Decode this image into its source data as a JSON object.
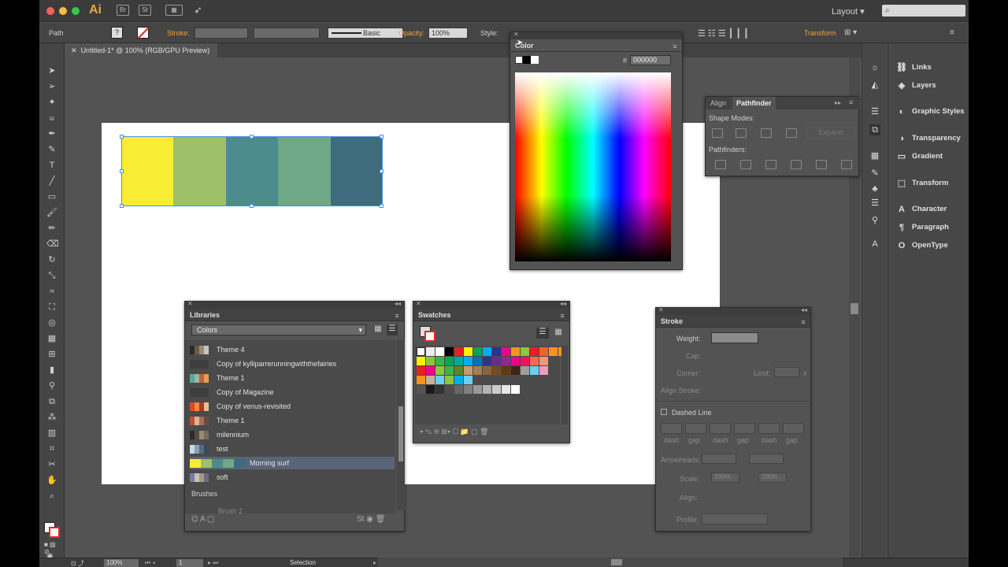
{
  "app": {
    "logo": "Ai",
    "workspace": "Layout",
    "search_placeholder": ""
  },
  "control_bar": {
    "path_label": "Path",
    "stroke_label": "Stroke:",
    "brush_label": "Basic",
    "opacity_label": "Opacity:",
    "opacity_value": "100%",
    "style_label": "Style:",
    "transform_label": "Transform"
  },
  "document": {
    "tab_title": "Untitled-1* @ 100% (RGB/GPU Preview)"
  },
  "artboard": {
    "rects": [
      {
        "color": "#f8ed33"
      },
      {
        "color": "#9dc068"
      },
      {
        "color": "#4c8c8c"
      },
      {
        "color": "#6fa887"
      },
      {
        "color": "#3e6b7d"
      }
    ]
  },
  "color_panel": {
    "title": "Color",
    "hex_label": "#",
    "hex_value": "000000"
  },
  "pathfinder_panel": {
    "tabs": [
      "Align",
      "Pathfinder"
    ],
    "shape_modes_label": "Shape Modes:",
    "expand_label": "Expand",
    "pathfinders_label": "Pathfinders:"
  },
  "libraries_panel": {
    "title": "Libraries",
    "dropdown_value": "Colors",
    "items": [
      {
        "label": "Theme 4",
        "colors": [
          "#2b2b2b",
          "#6a5a4a",
          "#9a8a7a",
          "#c9c3b9"
        ]
      },
      {
        "label": "Copy of kylliparrerunningwiththefairies",
        "colors": []
      },
      {
        "label": "Theme 1",
        "colors": [
          "#58a8a0",
          "#9ab8a0",
          "#c06040",
          "#e0a050"
        ]
      },
      {
        "label": "Copy of Magazine",
        "colors": []
      },
      {
        "label": "Copy of venus-revisited",
        "colors": [
          "#d84a2a",
          "#f08a3a",
          "#a83a2a",
          "#e0c090"
        ]
      },
      {
        "label": "Theme 1",
        "colors": [
          "#c05030",
          "#e0b090",
          "#a07060",
          "#6a4a3a"
        ]
      },
      {
        "label": "milennium",
        "colors": [
          "#2a2a2a",
          "#5a4a3a",
          "#9a8a7a",
          "#7a6a5a"
        ]
      },
      {
        "label": "test",
        "colors": [
          "#c8d8e8",
          "#8aa0b8",
          "#5a6a7a",
          "#3a4a5a"
        ]
      },
      {
        "label": "Morning surf",
        "colors": [
          "#f8ed33",
          "#9dc068",
          "#4c8c8c",
          "#6fa887",
          "#3e6b7d"
        ],
        "selected": true
      },
      {
        "label": "soft",
        "colors": [
          "#7a7aa0",
          "#c8c0b8",
          "#a89888",
          "#6a6a8a"
        ]
      }
    ],
    "section_brushes": "Brushes",
    "brush_item": "Brush 2"
  },
  "swatches_panel": {
    "title": "Swatches",
    "rows": [
      [
        "#ffffff",
        "#000000",
        "#ed1c24",
        "#fff200",
        "#00a651",
        "#00aeef",
        "#2e3192",
        "#ec008c",
        "#f7941d",
        "#8dc63f",
        "#ed1c24",
        "#f26522",
        "#f7941d",
        "#f7941d"
      ],
      [
        "#fff200",
        "#8dc63f",
        "#39b54a",
        "#00a651",
        "#00a99d",
        "#00aeef",
        "#0072bc",
        "#2e3192",
        "#662d91",
        "#92278f",
        "#ec008c",
        "#ed145b",
        "#f26c4f",
        "#f69679"
      ],
      [
        "#ed1c24",
        "#ec008c",
        "#8dc63f",
        "#39b54a",
        "#598527",
        "#c69c6d",
        "#a67c52",
        "#8c6239",
        "#754c24",
        "#603913",
        "#3c2415",
        "#9e9e9e",
        "#6dcff6",
        "#f49ac1"
      ],
      [
        "#f7941d",
        "#c7b299",
        "#6dcff6",
        "#8dc63f",
        "#00aeef",
        "#6dcff6"
      ],
      [
        "#555555",
        "#1a1a1a",
        "#333333",
        "#4d4d4d",
        "#666666",
        "#808080",
        "#999999",
        "#b3b3b3",
        "#cccccc",
        "#e6e6e6",
        "#ffffff"
      ]
    ]
  },
  "stroke_panel": {
    "title": "Stroke",
    "weight_label": "Weight:",
    "cap_label": "Cap:",
    "corner_label": "Corner:",
    "limit_label": "Limit:",
    "limit_suffix": "x",
    "align_label": "Align Stroke:",
    "dashed_label": "Dashed Line",
    "dash_labels": [
      "dash",
      "gap",
      "dash",
      "gap",
      "dash",
      "gap"
    ],
    "arrowheads_label": "Arrowheads:",
    "scale_label": "Scale:",
    "scale_value1": "100%",
    "scale_value2": "100%",
    "align2_label": "Align:",
    "profile_label": "Profile:"
  },
  "dock": {
    "items": [
      {
        "label": "Links",
        "icon": "link-icon",
        "glyph": "⛓"
      },
      {
        "label": "Layers",
        "icon": "layers-icon",
        "glyph": "◈"
      },
      {
        "label": "Graphic Styles",
        "icon": "graphic-styles-icon",
        "glyph": "◐"
      },
      {
        "label": "Transparency",
        "icon": "transparency-icon",
        "glyph": "◑"
      },
      {
        "label": "Gradient",
        "icon": "gradient-icon",
        "glyph": "▭"
      },
      {
        "label": "Transform",
        "icon": "transform-icon",
        "glyph": "⬚"
      },
      {
        "label": "Character",
        "icon": "character-icon",
        "glyph": "A"
      },
      {
        "label": "Paragraph",
        "icon": "paragraph-icon",
        "glyph": "¶"
      },
      {
        "label": "OpenType",
        "icon": "opentype-icon",
        "glyph": "O"
      }
    ]
  },
  "status_bar": {
    "zoom": "100%",
    "page": "1",
    "tool": "Selection"
  }
}
